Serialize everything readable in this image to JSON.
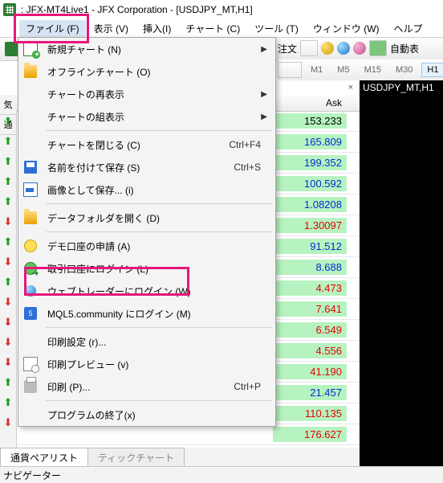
{
  "window": {
    "title": ": JFX-MT4Live1 - JFX Corporation - [USDJPY_MT,H1]"
  },
  "menubar": {
    "file": "ファイル (F)",
    "view": "表示 (V)",
    "insert": "挿入(I)",
    "chart": "チャート (C)",
    "tool": "ツール (T)",
    "window": "ウィンドウ (W)",
    "help": "ヘルプ"
  },
  "toolbar_right": {
    "order_label": "注文",
    "auto_label": "自動表"
  },
  "timeframes": {
    "m1": "M1",
    "m5": "M5",
    "m15": "M15",
    "m30": "M30",
    "h1": "H1"
  },
  "side_tabs": {
    "a": "気",
    "b": "通"
  },
  "grid": {
    "ask_header": "Ask"
  },
  "rows": [
    {
      "dir": "up",
      "ask": "153.233",
      "cls": "black"
    },
    {
      "dir": "up",
      "ask": "165.809",
      "cls": "blue"
    },
    {
      "dir": "up",
      "ask": "199.352",
      "cls": "blue"
    },
    {
      "dir": "up",
      "ask": "100.592",
      "cls": "blue"
    },
    {
      "dir": "up",
      "ask": "1.08208",
      "cls": "blue"
    },
    {
      "dir": "down",
      "ask": "1.30097",
      "cls": "red"
    },
    {
      "dir": "up",
      "ask": "91.512",
      "cls": "blue"
    },
    {
      "dir": "down",
      "ask": "8.688",
      "cls": "blue"
    },
    {
      "dir": "up",
      "ask": "4.473",
      "cls": "red"
    },
    {
      "dir": "down",
      "ask": "7.641",
      "cls": "red"
    },
    {
      "dir": "down",
      "ask": "6.549",
      "cls": "red"
    },
    {
      "dir": "down",
      "ask": "4.556",
      "cls": "red"
    },
    {
      "dir": "down",
      "ask": "41.190",
      "cls": "red"
    },
    {
      "dir": "up",
      "ask": "21.457",
      "cls": "blue"
    },
    {
      "dir": "up",
      "ask": "110.135",
      "cls": "red"
    },
    {
      "dir": "down",
      "ask": "176.627",
      "cls": "red"
    }
  ],
  "bottom_tabs": {
    "pairs": "通貨ペアリスト",
    "tick": "ティックチャート"
  },
  "chart": {
    "title": "USDJPY_MT,H1"
  },
  "navigator": {
    "label": "ナビゲーター"
  },
  "file_menu": {
    "new_chart": "新規チャート (N)",
    "offline_chart": "オフラインチャート (O)",
    "reopen": "チャートの再表示",
    "profiles": "チャートの組表示",
    "close_chart": "チャートを閉じる (C)",
    "close_accel": "Ctrl+F4",
    "save_as": "名前を付けて保存 (S)",
    "save_accel": "Ctrl+S",
    "save_image": "画像として保存... (i)",
    "open_data": "データフォルダを開く (D)",
    "demo": "デモ口座の申請 (A)",
    "login": "取引口座にログイン (L)",
    "webtrader": "ウェブトレーダーにログイン (W)",
    "mql5": "MQL5.community にログイン (M)",
    "print_setup": "印刷設定 (r)...",
    "print_preview": "印刷プレビュー (v)",
    "print": "印刷 (P)...",
    "print_accel": "Ctrl+P",
    "exit": "プログラムの終了(x)"
  }
}
